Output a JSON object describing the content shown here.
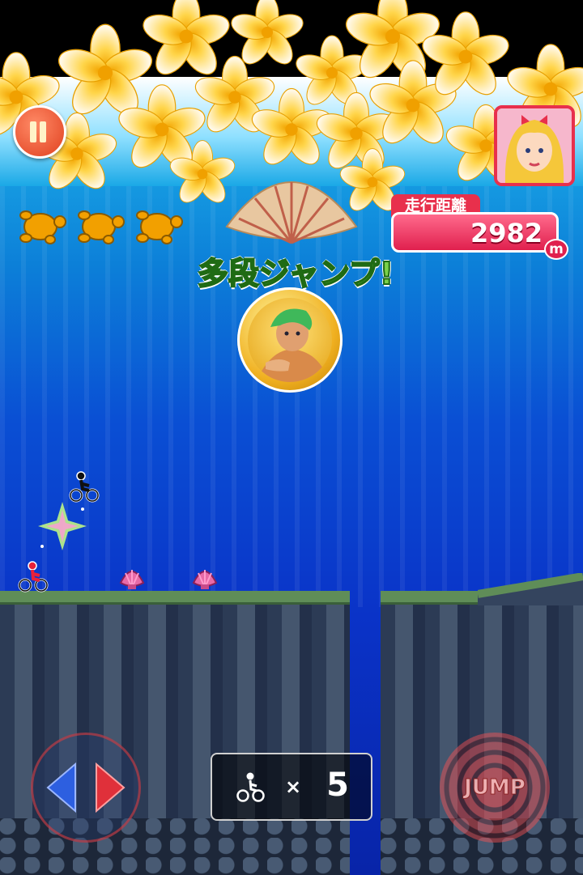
{
  "hud": {
    "distance_label": "走行距離",
    "distance_value": "2982",
    "distance_unit": "m",
    "lives": 3
  },
  "banner": {
    "combo_text": "多段ジャンプ!"
  },
  "controls": {
    "jump_label": "JUMP"
  },
  "counter": {
    "multiplier": "×",
    "count": "5"
  },
  "icons": [
    "pause-icon",
    "turtle-icon",
    "cyclist-icon",
    "shell-icon",
    "left-arrow-icon",
    "right-arrow-icon"
  ],
  "colors": {
    "distance_accent": "#e8304c",
    "combo_text": "#7bd14a",
    "water_top": "#1aa8e6",
    "water_bottom": "#0824a8"
  }
}
